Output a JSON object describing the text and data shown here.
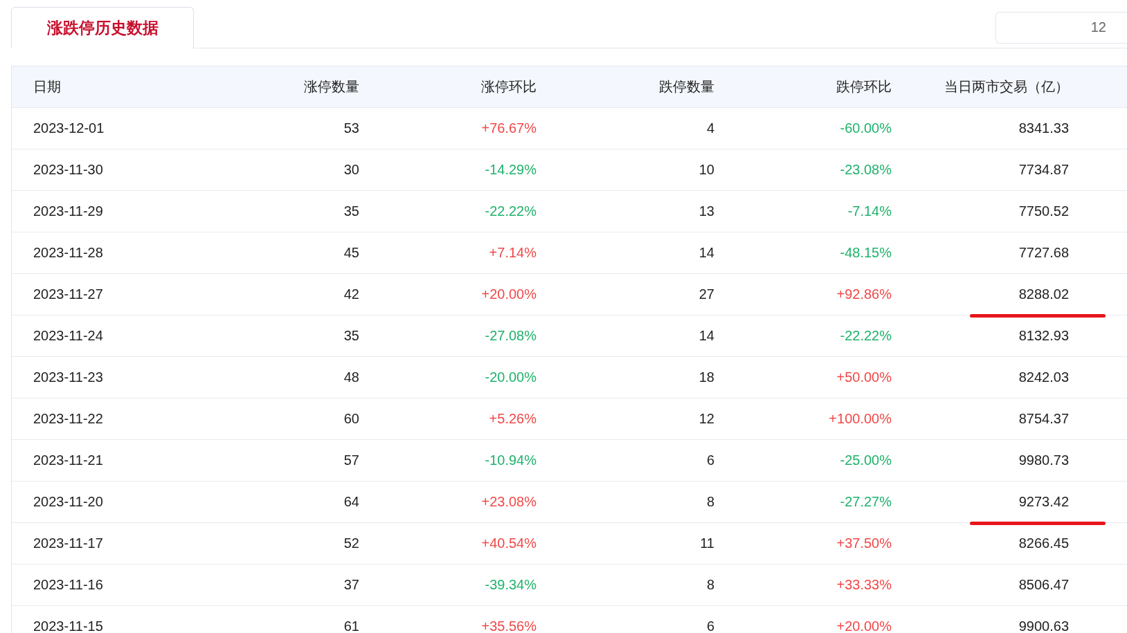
{
  "tab": {
    "label": "涨跌停历史数据",
    "selected": true
  },
  "date_box": {
    "value": "12"
  },
  "table": {
    "columns": [
      "日期",
      "涨停数量",
      "涨停环比",
      "跌停数量",
      "跌停环比",
      "当日两市交易（亿）"
    ],
    "rows": [
      {
        "date": "2023-12-01",
        "up_count": "53",
        "up_change": {
          "text": "+76.67%",
          "rise": true
        },
        "down_count": "4",
        "down_change": {
          "text": "-60.00%",
          "rise": false
        },
        "turnover": "8341.33",
        "underlined": false
      },
      {
        "date": "2023-11-30",
        "up_count": "30",
        "up_change": {
          "text": "-14.29%",
          "rise": false
        },
        "down_count": "10",
        "down_change": {
          "text": "-23.08%",
          "rise": false
        },
        "turnover": "7734.87",
        "underlined": false
      },
      {
        "date": "2023-11-29",
        "up_count": "35",
        "up_change": {
          "text": "-22.22%",
          "rise": false
        },
        "down_count": "13",
        "down_change": {
          "text": "-7.14%",
          "rise": false
        },
        "turnover": "7750.52",
        "underlined": false
      },
      {
        "date": "2023-11-28",
        "up_count": "45",
        "up_change": {
          "text": "+7.14%",
          "rise": true
        },
        "down_count": "14",
        "down_change": {
          "text": "-48.15%",
          "rise": false
        },
        "turnover": "7727.68",
        "underlined": false
      },
      {
        "date": "2023-11-27",
        "up_count": "42",
        "up_change": {
          "text": "+20.00%",
          "rise": true
        },
        "down_count": "27",
        "down_change": {
          "text": "+92.86%",
          "rise": true
        },
        "turnover": "8288.02",
        "underlined": true
      },
      {
        "date": "2023-11-24",
        "up_count": "35",
        "up_change": {
          "text": "-27.08%",
          "rise": false
        },
        "down_count": "14",
        "down_change": {
          "text": "-22.22%",
          "rise": false
        },
        "turnover": "8132.93",
        "underlined": false
      },
      {
        "date": "2023-11-23",
        "up_count": "48",
        "up_change": {
          "text": "-20.00%",
          "rise": false
        },
        "down_count": "18",
        "down_change": {
          "text": "+50.00%",
          "rise": true
        },
        "turnover": "8242.03",
        "underlined": false
      },
      {
        "date": "2023-11-22",
        "up_count": "60",
        "up_change": {
          "text": "+5.26%",
          "rise": true
        },
        "down_count": "12",
        "down_change": {
          "text": "+100.00%",
          "rise": true
        },
        "turnover": "8754.37",
        "underlined": false
      },
      {
        "date": "2023-11-21",
        "up_count": "57",
        "up_change": {
          "text": "-10.94%",
          "rise": false
        },
        "down_count": "6",
        "down_change": {
          "text": "-25.00%",
          "rise": false
        },
        "turnover": "9980.73",
        "underlined": false
      },
      {
        "date": "2023-11-20",
        "up_count": "64",
        "up_change": {
          "text": "+23.08%",
          "rise": true
        },
        "down_count": "8",
        "down_change": {
          "text": "-27.27%",
          "rise": false
        },
        "turnover": "9273.42",
        "underlined": true
      },
      {
        "date": "2023-11-17",
        "up_count": "52",
        "up_change": {
          "text": "+40.54%",
          "rise": true
        },
        "down_count": "11",
        "down_change": {
          "text": "+37.50%",
          "rise": true
        },
        "turnover": "8266.45",
        "underlined": false
      },
      {
        "date": "2023-11-16",
        "up_count": "37",
        "up_change": {
          "text": "-39.34%",
          "rise": false
        },
        "down_count": "8",
        "down_change": {
          "text": "+33.33%",
          "rise": true
        },
        "turnover": "8506.47",
        "underlined": false
      },
      {
        "date": "2023-11-15",
        "up_count": "61",
        "up_change": {
          "text": "+35.56%",
          "rise": true
        },
        "down_count": "6",
        "down_change": {
          "text": "+20.00%",
          "rise": true
        },
        "turnover": "9900.63",
        "underlined": false
      }
    ]
  }
}
